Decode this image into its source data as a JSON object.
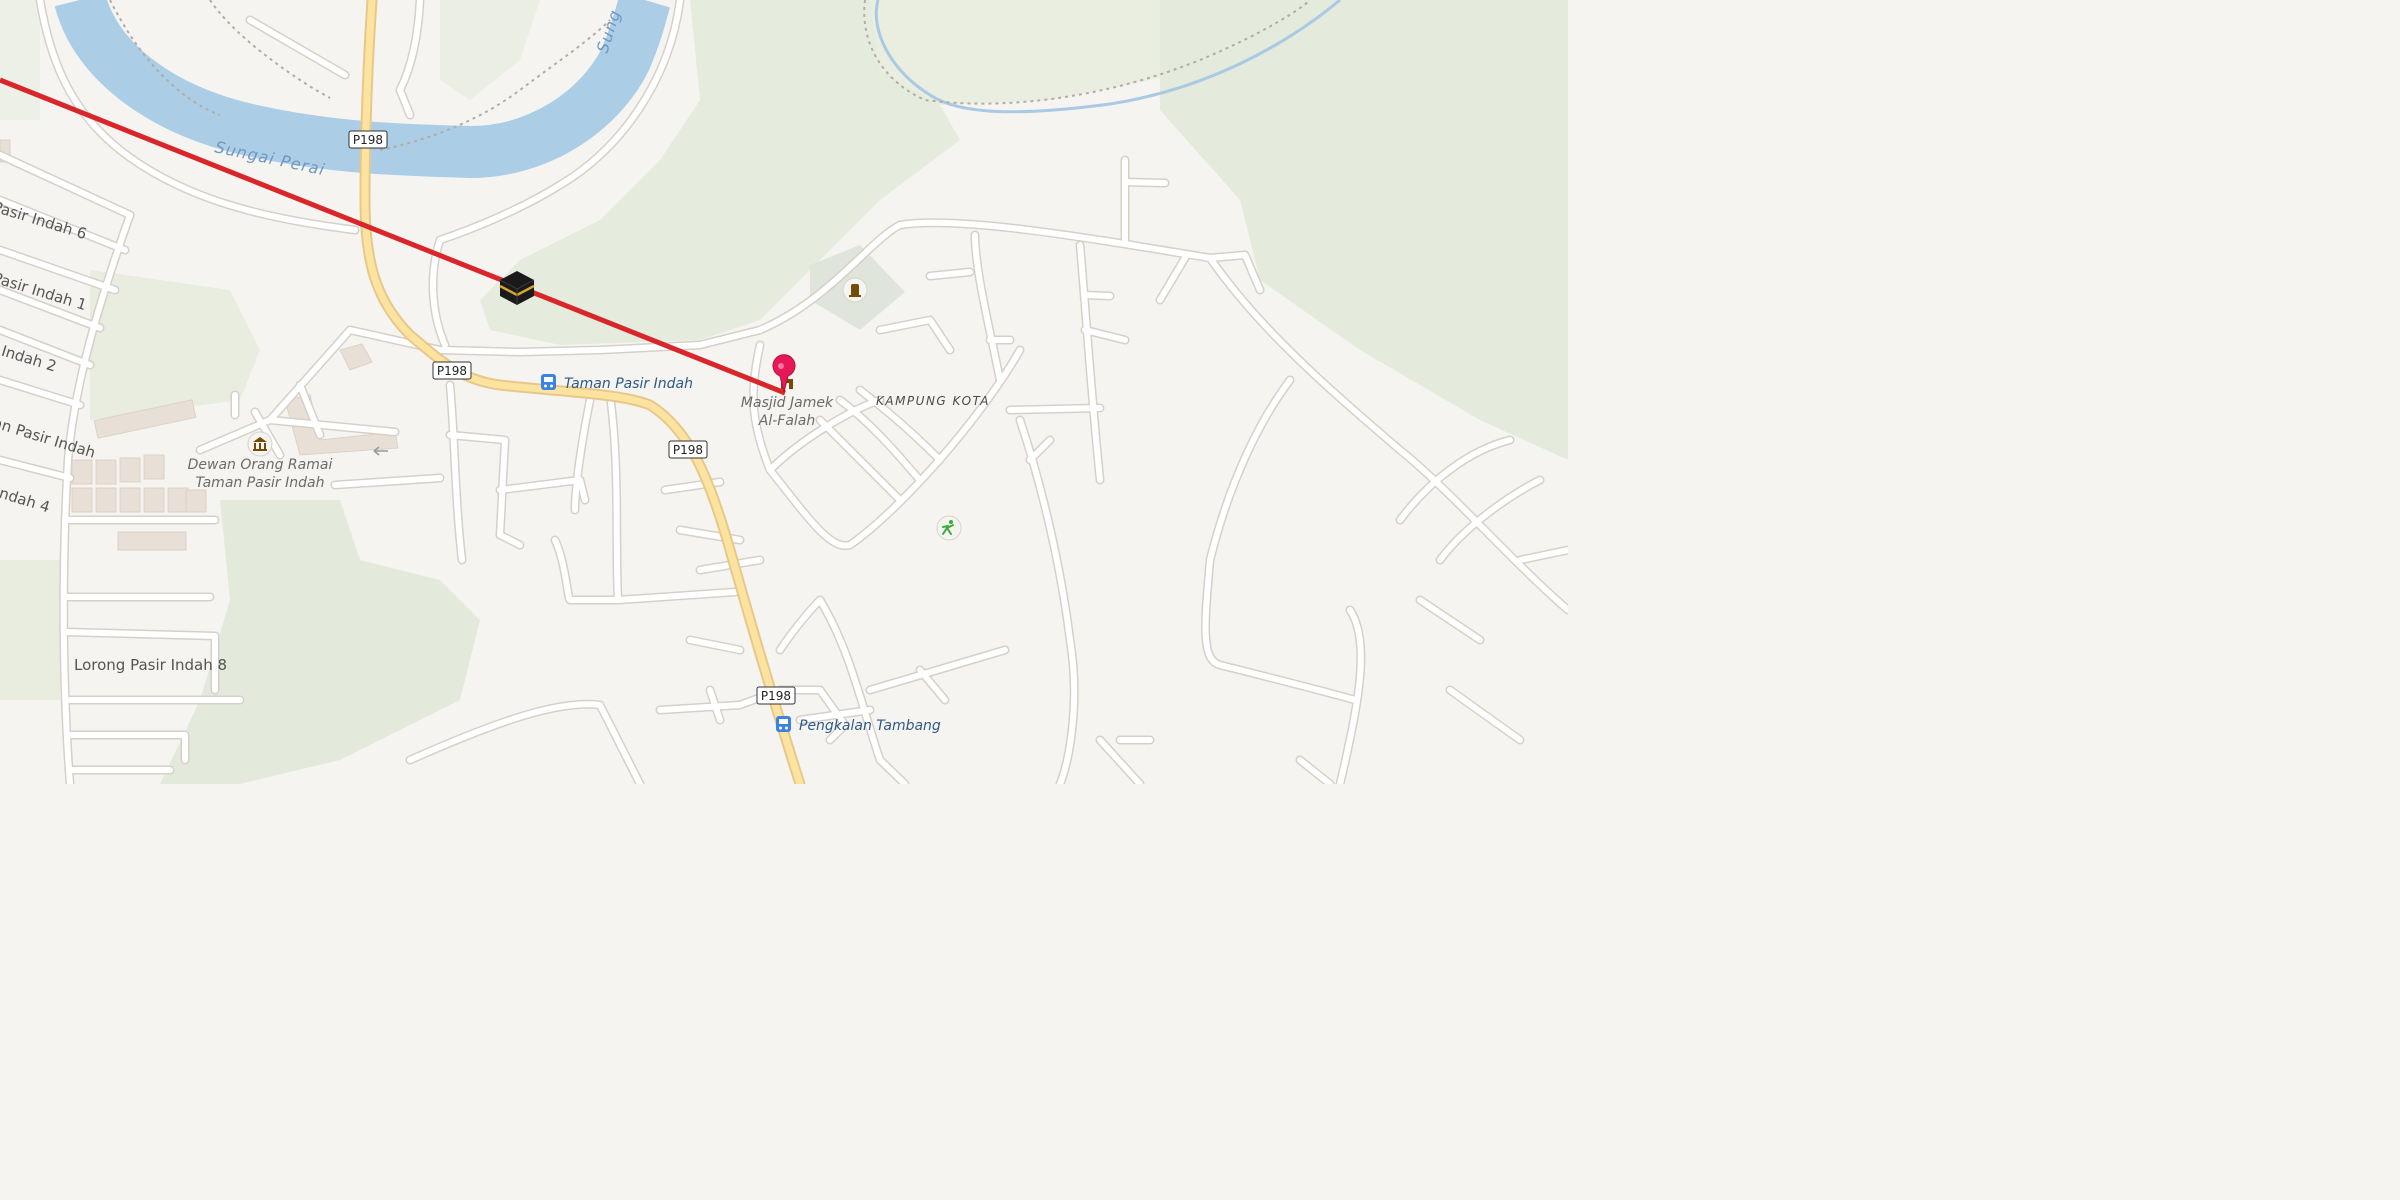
{
  "map": {
    "water_label_river": "Sungai Perai",
    "water_label_river_top": "Sung",
    "route_shields": [
      "P198",
      "P198",
      "P198",
      "P198"
    ],
    "streets": {
      "s1": "Pasir Indah 6",
      "s2": "Pasir Indah 1",
      "s3": "r Indah 2",
      "s4": "an Pasir Indah",
      "s5": "Indah 4",
      "s6": "Lorong Pasir Indah 8"
    },
    "places": {
      "hall_line1": "Dewan Orang Ramai",
      "hall_line2": "Taman Pasir Indah",
      "mosque_line1": "Masjid Jamek",
      "mosque_line2": "Al-Falah",
      "area": "KAMPUNG KOTA"
    },
    "transit": {
      "stop1": "Taman Pasir Indah",
      "stop2": "Pengkalan Tambang"
    },
    "icons": {
      "kaaba": "kaaba-icon",
      "pin": "location-pin-icon",
      "hall": "town-hall-icon",
      "cemetery": "cemetery-icon",
      "park": "playground-icon",
      "bus": "bus-stop-icon"
    },
    "colors": {
      "qibla_line": "#d9262b",
      "pin": "#e6185a",
      "highway": "#fde3a0",
      "water": "#abcde6",
      "bus": "#3b82e6",
      "green": "#e9eee0"
    }
  }
}
